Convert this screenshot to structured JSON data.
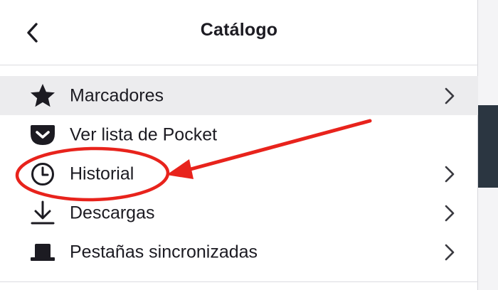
{
  "panel": {
    "title": "Catálogo",
    "back_icon": "chevron-left-icon"
  },
  "items": [
    {
      "label": "Marcadores",
      "icon": "star-icon",
      "has_submenu": true,
      "hovered": true
    },
    {
      "label": "Ver lista de Pocket",
      "icon": "pocket-icon",
      "has_submenu": false
    },
    {
      "label": "Historial",
      "icon": "clock-icon",
      "has_submenu": true,
      "annotated": true
    },
    {
      "label": "Descargas",
      "icon": "download-icon",
      "has_submenu": true
    },
    {
      "label": "Pestañas sincronizadas",
      "icon": "synced-tabs-icon",
      "has_submenu": true
    }
  ],
  "colors": {
    "text": "#1c1b22",
    "hover_bg": "#ececee",
    "annotation": "#e8231c"
  }
}
